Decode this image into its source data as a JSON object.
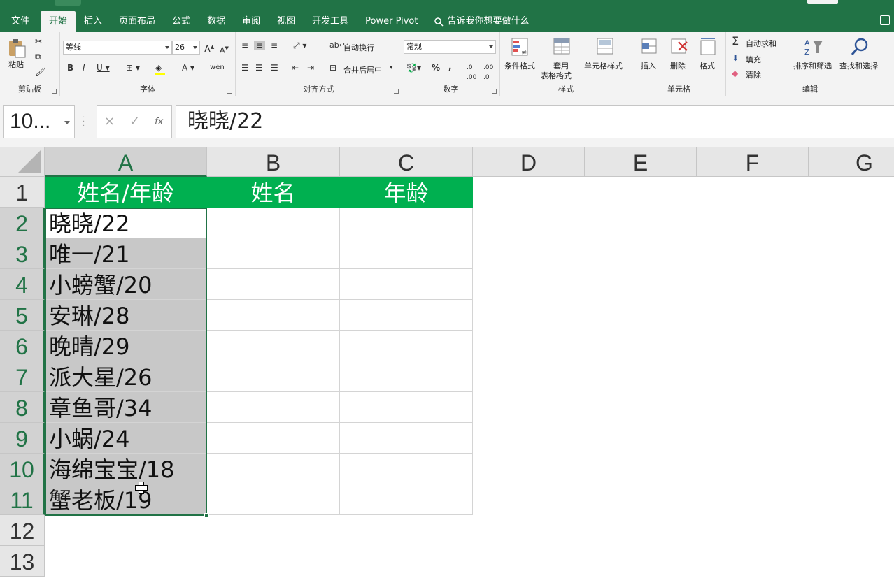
{
  "ribbon": {
    "tabs": [
      "文件",
      "开始",
      "插入",
      "页面布局",
      "公式",
      "数据",
      "审阅",
      "视图",
      "开发工具",
      "Power Pivot"
    ],
    "active_tab": "开始",
    "tell_me": "告诉我你想要做什么",
    "clipboard": {
      "paste": "粘贴",
      "label": "剪贴板"
    },
    "font": {
      "name": "等线",
      "size": "26",
      "label": "字体"
    },
    "alignment": {
      "wrap_text": "自动换行",
      "merge_center": "合并后居中",
      "label": "对齐方式"
    },
    "number": {
      "format": "常规",
      "percent": "%",
      "comma": ",",
      "label": "数字"
    },
    "styles": {
      "conditional": "条件格式",
      "table_line1": "套用",
      "table_line2": "表格格式",
      "cell_styles": "单元格样式",
      "label": "样式"
    },
    "cells": {
      "insert": "插入",
      "delete": "删除",
      "format": "格式",
      "label": "单元格"
    },
    "editing": {
      "autosum": "自动求和",
      "fill": "填充",
      "clear": "清除",
      "sort_filter": "排序和筛选",
      "find_select": "查找和选择",
      "label": "编辑"
    }
  },
  "formula_bar": {
    "name_box": "10...",
    "cancel": "×",
    "enter": "✓",
    "fx": "fx",
    "content": "晓晓/22"
  },
  "sheet": {
    "columns": [
      "A",
      "B",
      "C",
      "D",
      "E",
      "F",
      "G"
    ],
    "rows": [
      "1",
      "2",
      "3",
      "4",
      "5",
      "6",
      "7",
      "8",
      "9",
      "10",
      "11",
      "12",
      "13"
    ],
    "header_row": [
      "姓名/年龄",
      "姓名",
      "年龄"
    ],
    "col_a_values": [
      "晓晓/22",
      "唯一/21",
      "小螃蟹/20",
      "安琳/28",
      "晚晴/29",
      "派大星/26",
      "章鱼哥/34",
      "小蜗/24",
      "海绵宝宝/18",
      "蟹老板/19"
    ],
    "header_color": "#00b050",
    "selection_color": "#217346"
  }
}
